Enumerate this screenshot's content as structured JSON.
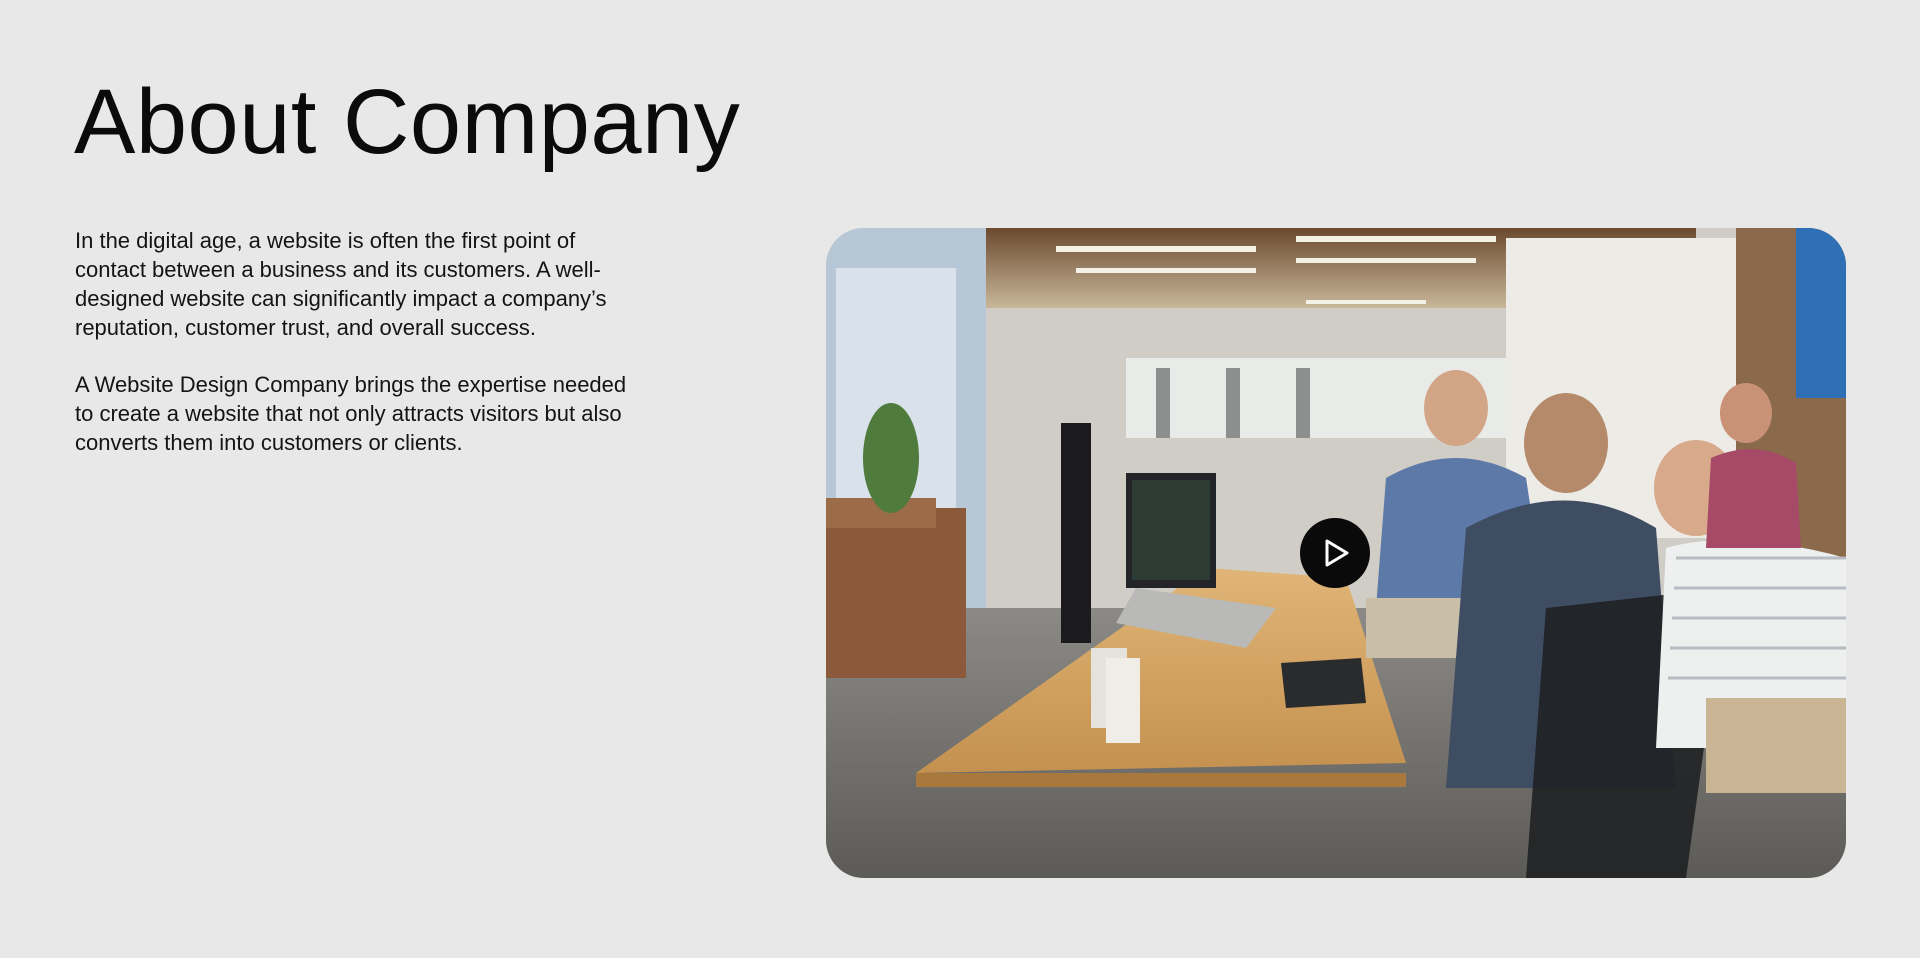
{
  "section": {
    "title": "About Company",
    "paragraphs": [
      "In the digital age, a website is often the first point of contact between a business and its customers. A well-designed website can significantly impact a company’s reputation, customer trust, and overall success.",
      "A Website Design Company brings the expertise needed to create a website that not only attracts visitors but also converts them into customers or clients."
    ]
  },
  "media": {
    "play_icon": "play-icon"
  },
  "colors": {
    "background": "#e8e8e8",
    "text": "#111111",
    "play_button": "#0a0a0a"
  }
}
